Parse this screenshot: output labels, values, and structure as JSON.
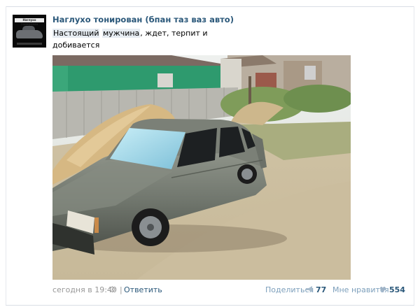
{
  "post": {
    "author": "Наглухо тонирован (бпан таз ваз авто)",
    "text_part1": "Настоящий",
    "text_part2": "мужчина",
    "text_part3": ", ждет, терпит и",
    "text_line2": "добивается",
    "avatar_logo_text": "Наглухо Тонирован"
  },
  "footer": {
    "time": "сегодня в 19:40",
    "separator": "|",
    "reply_label": "Ответить",
    "share_label": "Поделиться",
    "share_count": "77",
    "like_label": "Мне нравится",
    "like_count": "554"
  },
  "colors": {
    "link": "#2b587a",
    "muted": "#999999",
    "action": "#7ea0bc"
  },
  "icons": {
    "settings": "gear-icon",
    "share": "megaphone-icon",
    "like": "heart-icon"
  }
}
